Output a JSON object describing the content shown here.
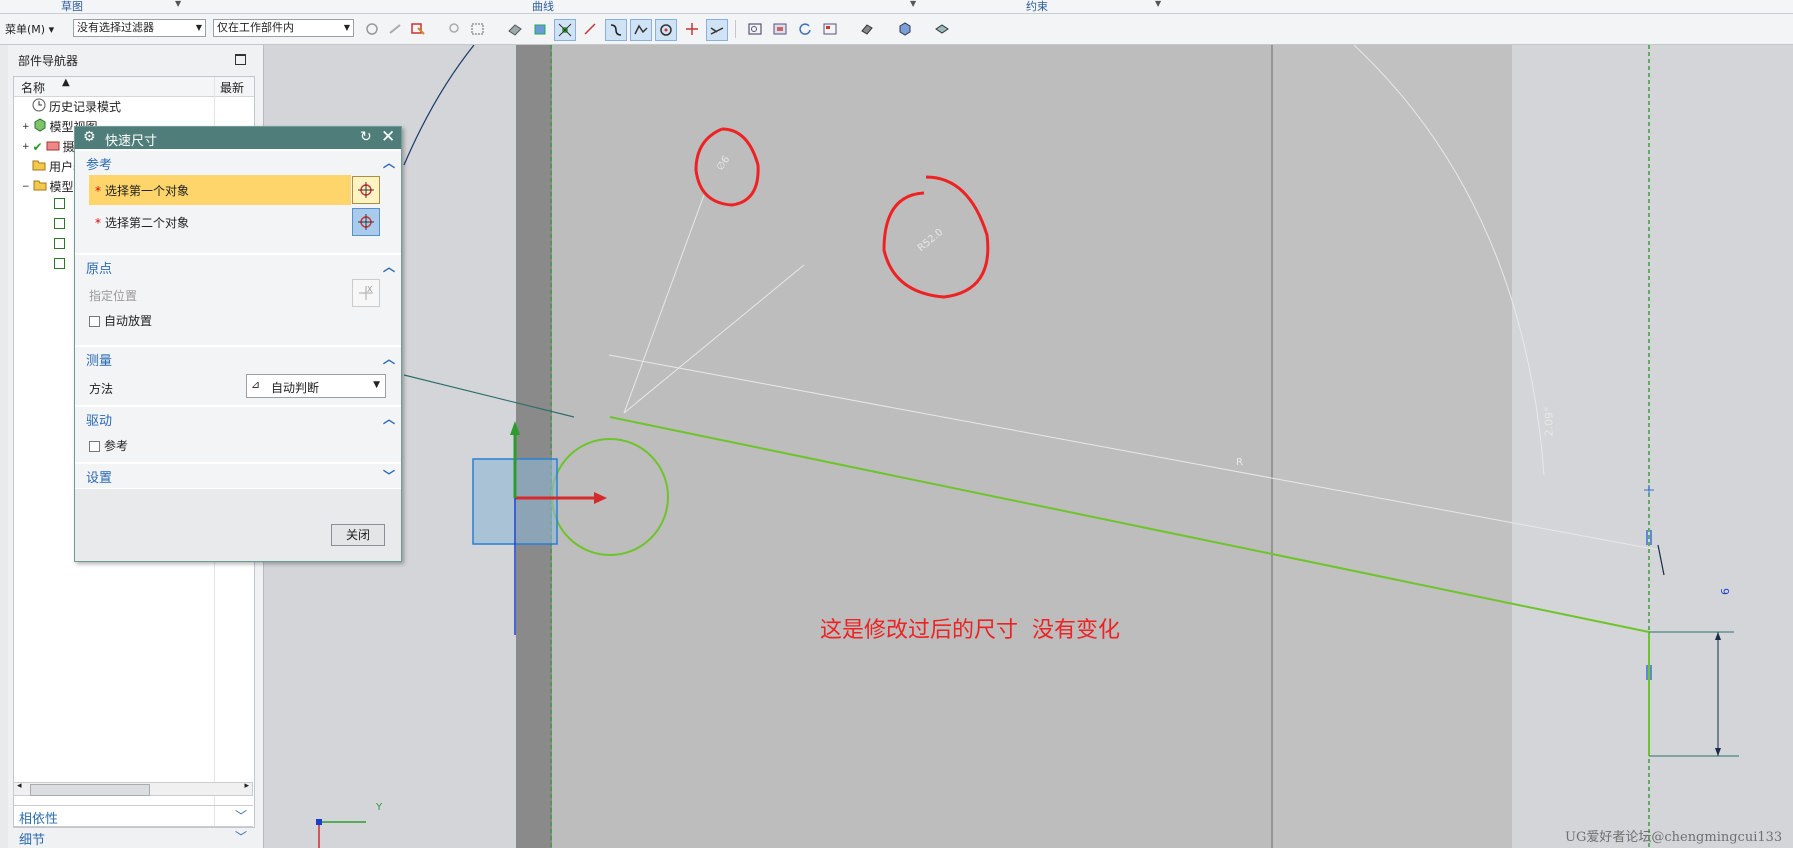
{
  "ribbon": {
    "groups": [
      "草图",
      "曲线",
      "约束"
    ]
  },
  "toolbar": {
    "menu_label": "菜单(M)",
    "filter_value": "没有选择过滤器",
    "scope_value": "仅在工作部件内",
    "icons": [
      "snap-icon",
      "snap2-icon",
      "select-icon",
      "lasso-icon",
      "box-select-icon",
      "face-icon",
      "body-icon",
      "snap-point-icon",
      "line-icon",
      "curve-icon",
      "arc-icon",
      "circle-icon",
      "cross-icon",
      "trim-icon",
      "view-icon",
      "frame-icon",
      "rotate-icon",
      "layout-icon",
      "shade-icon",
      "cube-icon",
      "display-icon"
    ]
  },
  "navigator": {
    "title": "部件导航器",
    "columns": {
      "name": "名称",
      "latest": "最新"
    },
    "items": [
      {
        "label": "历史记录模式",
        "icon": "clock-icon"
      },
      {
        "label": "模型视图",
        "icon": "model-view-icon"
      },
      {
        "label": "摄像机",
        "icon": "camera-icon"
      },
      {
        "label": "用户表达式",
        "icon": "folder-icon"
      },
      {
        "label": "模型历史记录",
        "icon": "folder-icon"
      }
    ],
    "sections": [
      {
        "label": "相依性"
      },
      {
        "label": "细节"
      }
    ]
  },
  "dialog": {
    "title": "快速尺寸",
    "reference": {
      "header": "参考",
      "first": "选择第一个对象",
      "second": "选择第二个对象"
    },
    "origin": {
      "header": "原点",
      "specify": "指定位置",
      "auto_place": "自动放置",
      "auto_place_checked": false
    },
    "measure": {
      "header": "测量",
      "method_label": "方法",
      "method_value": "自动判断"
    },
    "drive": {
      "header": "驱动",
      "reference": "参考",
      "reference_checked": false
    },
    "settings": {
      "header": "设置"
    },
    "close": "关闭"
  },
  "canvas": {
    "annotation": "这是修改过后的尺寸  没有变化",
    "dimension_labels": [
      "∅6",
      "R52.0",
      "2.09°",
      "6",
      "R"
    ],
    "axes": {
      "y": "Y"
    },
    "colors": {
      "annotation": "#ee2222",
      "sketch_curve": "#6ec42a",
      "axis_x": "#d42a2a",
      "axis_y": "#2e9b2e",
      "axis_z": "#1a3fd0"
    }
  },
  "watermark": "UG爱好者论坛@chengmingcui133"
}
